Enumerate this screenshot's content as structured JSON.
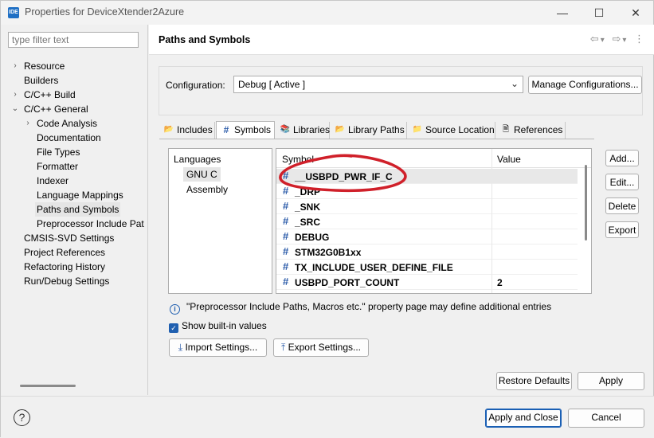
{
  "window": {
    "app_icon": "IDE",
    "title": "Properties for DeviceXtender2Azure",
    "min_label": "—",
    "max_label": "☐",
    "close_label": "✕"
  },
  "filter": {
    "placeholder": "type filter text"
  },
  "tree": [
    {
      "label": "Resource",
      "level": 0,
      "arrow": "›"
    },
    {
      "label": "Builders",
      "level": 0,
      "arrow": ""
    },
    {
      "label": "C/C++ Build",
      "level": 0,
      "arrow": "›"
    },
    {
      "label": "C/C++ General",
      "level": 0,
      "arrow": "⌄"
    },
    {
      "label": "Code Analysis",
      "level": 1,
      "arrow": "›"
    },
    {
      "label": "Documentation",
      "level": 1,
      "arrow": ""
    },
    {
      "label": "File Types",
      "level": 1,
      "arrow": ""
    },
    {
      "label": "Formatter",
      "level": 1,
      "arrow": ""
    },
    {
      "label": "Indexer",
      "level": 1,
      "arrow": ""
    },
    {
      "label": "Language Mappings",
      "level": 1,
      "arrow": ""
    },
    {
      "label": "Paths and Symbols",
      "level": 1,
      "arrow": "",
      "selected": true
    },
    {
      "label": "Preprocessor Include Pat",
      "level": 1,
      "arrow": ""
    },
    {
      "label": "CMSIS-SVD Settings",
      "level": 0,
      "arrow": ""
    },
    {
      "label": "Project References",
      "level": 0,
      "arrow": ""
    },
    {
      "label": "Refactoring History",
      "level": 0,
      "arrow": ""
    },
    {
      "label": "Run/Debug Settings",
      "level": 0,
      "arrow": ""
    }
  ],
  "page": {
    "title": "Paths and Symbols",
    "nav": {
      "back": "⇦",
      "back_menu": "▾",
      "forward": "⇨",
      "forward_menu": "▾",
      "more": "⋮"
    }
  },
  "configuration": {
    "label": "Configuration:",
    "value": "Debug  [ Active ]",
    "chevron": "⌄",
    "manage_button": "Manage Configurations..."
  },
  "tabs": [
    {
      "label": "Includes",
      "icon": "includes-icon",
      "glyph": "📂"
    },
    {
      "label": "Symbols",
      "icon": "symbols-icon",
      "glyph": "#",
      "active": true
    },
    {
      "label": "Libraries",
      "icon": "libraries-icon",
      "glyph": "📚"
    },
    {
      "label": "Library Paths",
      "icon": "library-paths-icon",
      "glyph": "📂"
    },
    {
      "label": "Source Location",
      "icon": "source-location-icon",
      "glyph": "📁"
    },
    {
      "label": "References",
      "icon": "references-icon",
      "glyph": "🗎"
    }
  ],
  "languages": {
    "title": "Languages",
    "items": [
      {
        "label": "GNU C",
        "selected": true
      },
      {
        "label": "Assembly",
        "selected": false
      }
    ]
  },
  "symbols": {
    "columns": {
      "symbol": "Symbol",
      "value": "Value"
    },
    "rows": [
      {
        "name": "__USBPD_PWR_IF_C",
        "value": "",
        "selected": true
      },
      {
        "name": "_DRP",
        "value": ""
      },
      {
        "name": "_SNK",
        "value": ""
      },
      {
        "name": "_SRC",
        "value": ""
      },
      {
        "name": "DEBUG",
        "value": ""
      },
      {
        "name": "STM32G0B1xx",
        "value": ""
      },
      {
        "name": "TX_INCLUDE_USER_DEFINE_FILE",
        "value": ""
      },
      {
        "name": "USBPD_PORT_COUNT",
        "value": "2"
      }
    ]
  },
  "side_buttons": {
    "add": "Add...",
    "edit": "Edit...",
    "delete": "Delete",
    "export": "Export"
  },
  "info_text": "\"Preprocessor Include Paths, Macros etc.\" property page may define additional entries",
  "show_builtin": {
    "label": "Show built-in values",
    "checked": true
  },
  "import_button": "Import Settings...",
  "export_button": "Export Settings...",
  "restore_defaults": "Restore Defaults",
  "apply": "Apply",
  "apply_and_close": "Apply and Close",
  "cancel": "Cancel",
  "help_glyph": "?",
  "colors": {
    "accent": "#1f5fb0",
    "annotation": "#d0202a"
  }
}
